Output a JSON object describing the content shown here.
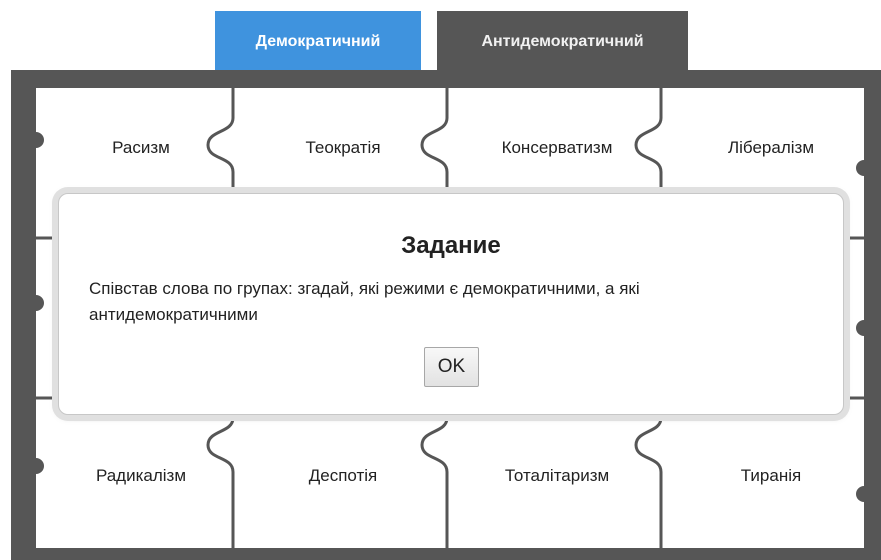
{
  "tabs": [
    {
      "label": "Демократичний",
      "color": "#3f93de"
    },
    {
      "label": "Антидемократичний",
      "color": "#565656"
    }
  ],
  "board": {
    "background": "#565656",
    "rows": [
      [
        "Расизм",
        "Теократія",
        "Консерватизм",
        "Лібералізм"
      ],
      [
        "",
        "",
        "",
        ""
      ],
      [
        "Радикалізм",
        "Деспотія",
        "Тоталітаризм",
        "Тиранія"
      ]
    ]
  },
  "dialog": {
    "title": "Задание",
    "message": "Співстав слова по групах: згадай, які режими є демократичними, а які антидемократичними",
    "ok_label": "OK"
  }
}
